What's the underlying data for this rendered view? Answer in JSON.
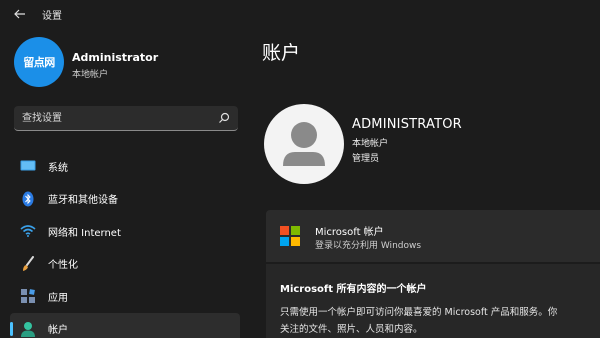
{
  "titlebar": {
    "title": "设置",
    "back_icon": "arrow-left-icon"
  },
  "profile": {
    "avatar_text": "留点网",
    "avatar_color": "#1b8fe8",
    "name": "Administrator",
    "account_type": "本地帐户"
  },
  "search": {
    "placeholder": "查找设置",
    "icon": "search-icon"
  },
  "nav": {
    "items": [
      {
        "label": "系统",
        "icon": "monitor-icon"
      },
      {
        "label": "蓝牙和其他设备",
        "icon": "bluetooth-icon"
      },
      {
        "label": "网络和 Internet",
        "icon": "wifi-icon"
      },
      {
        "label": "个性化",
        "icon": "brush-icon"
      },
      {
        "label": "应用",
        "icon": "apps-icon"
      },
      {
        "label": "帐户",
        "icon": "person-icon",
        "active": true
      }
    ]
  },
  "main": {
    "title": "账户",
    "account": {
      "name": "ADMINISTRATOR",
      "type": "本地帐户",
      "role": "管理员"
    },
    "ms_card": {
      "title": "Microsoft 帐户",
      "subtitle": "登录以充分利用 Windows"
    },
    "ms_expand": {
      "title": "Microsoft 所有内容的一个帐户",
      "line1": "只需使用一个帐户即可访问你最喜爱的 Microsoft 产品和服务。你",
      "line2": "关注的文件、照片、人员和内容。"
    }
  },
  "colors": {
    "background": "#1c1c1c",
    "accent": "#4cc2ff",
    "ms_red": "#f25022",
    "ms_green": "#7fba00",
    "ms_blue": "#00a4ef",
    "ms_yellow": "#ffb900"
  }
}
